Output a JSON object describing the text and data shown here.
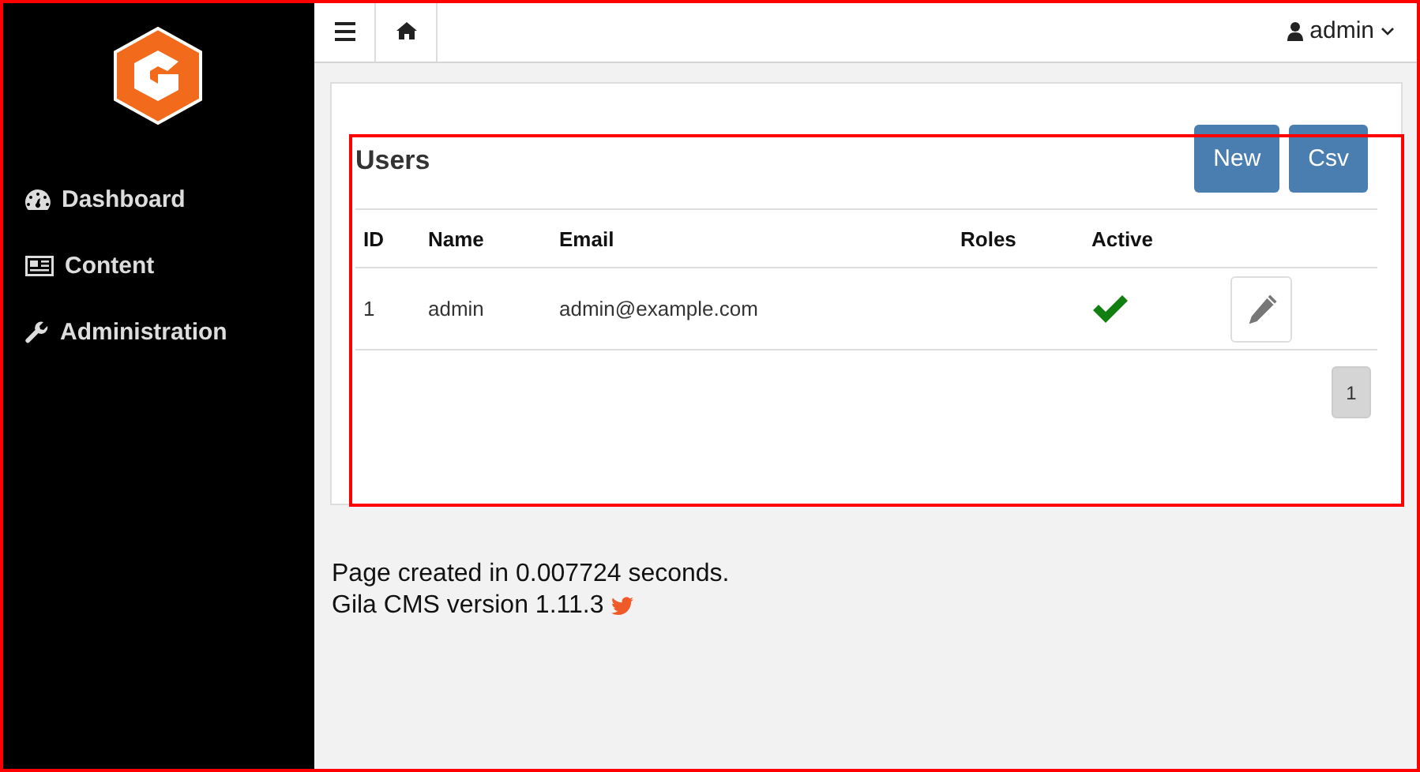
{
  "sidebar": {
    "items": [
      {
        "label": "Dashboard",
        "kind": "dashboard"
      },
      {
        "label": "Content",
        "kind": "content"
      },
      {
        "label": "Administration",
        "kind": "tools"
      }
    ]
  },
  "topbar": {
    "user": "admin"
  },
  "panel": {
    "title": "Users",
    "buttons": [
      "New",
      "Csv"
    ],
    "table": {
      "columns": [
        "ID",
        "Name",
        "Email",
        "Roles",
        "Active"
      ],
      "rows": [
        {
          "id": "1",
          "name": "admin",
          "email": "admin@example.com",
          "active": true
        }
      ]
    },
    "pages": [
      {
        "label": "1",
        "selected": true
      }
    ]
  },
  "footer": {
    "timing": "Page created in 0.007724 seconds.",
    "version": "Gila CMS version 1.11.3"
  },
  "annotations": {
    "window_frame": true,
    "panel_frame": true
  }
}
